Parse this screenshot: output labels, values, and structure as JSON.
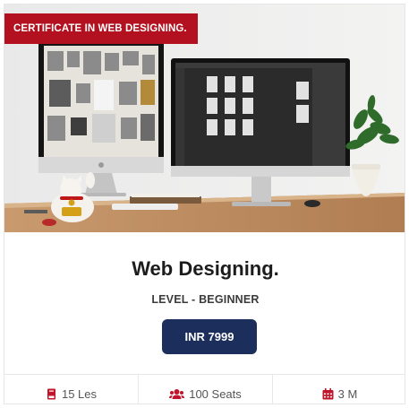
{
  "badge": {
    "label": "CERTIFICATE IN WEB DESIGNING."
  },
  "course": {
    "title": "Web Designing.",
    "level": "LEVEL - BEGINNER",
    "price_label": "INR 7999"
  },
  "stats": [
    {
      "label": "15 Les",
      "icon": "book-icon"
    },
    {
      "label": "100 Seats",
      "icon": "users-icon"
    },
    {
      "label": "3 M",
      "icon": "calendar-icon"
    }
  ],
  "colors": {
    "badge": "#b3111f",
    "button": "#1c2f5c",
    "icon_accent": "#c0152a"
  }
}
